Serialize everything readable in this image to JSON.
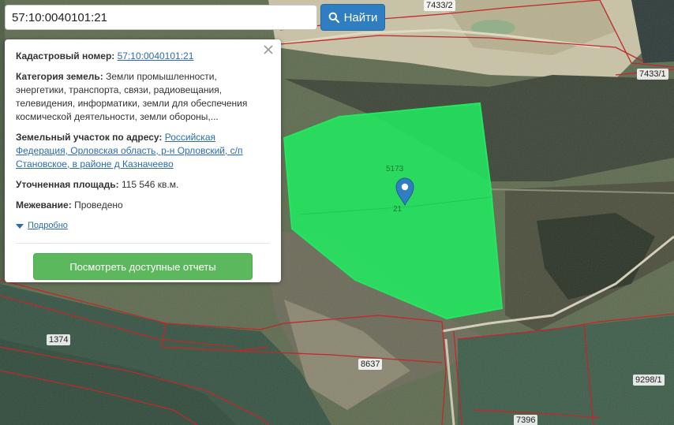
{
  "search": {
    "value": "57:10:0040101:21",
    "button_label": "Найти"
  },
  "popup": {
    "cadastral_label": "Кадастровый номер:",
    "cadastral_value": "57:10:0040101:21",
    "category_label": "Категория земель:",
    "category_value": "Земли промышленности, энергетики, транспорта, связи, радиовещания, телевидения, информатики, земли для обеспечения космической деятельности, земли обороны,...",
    "address_label": "Земельный участок по адресу:",
    "address_value": "Российская Федерация, Орловская область, р-н Орловский, с/п Становское, в районе д Казначеево",
    "area_label": "Уточненная площадь:",
    "area_value": "115 546 кв.м.",
    "survey_label": "Межевание:",
    "survey_value": "Проведено",
    "more_label": "Подробно",
    "report_button": "Посмотреть доступные отчеты"
  },
  "map": {
    "parcel_labels": [
      "7433/2",
      "7433/1",
      "1374",
      "8637",
      "9298/1",
      "7396",
      "5173",
      "21"
    ],
    "highlight_color": "#22e860",
    "boundary_color": "#c0282c",
    "marker_color": "#2f7ec2"
  }
}
